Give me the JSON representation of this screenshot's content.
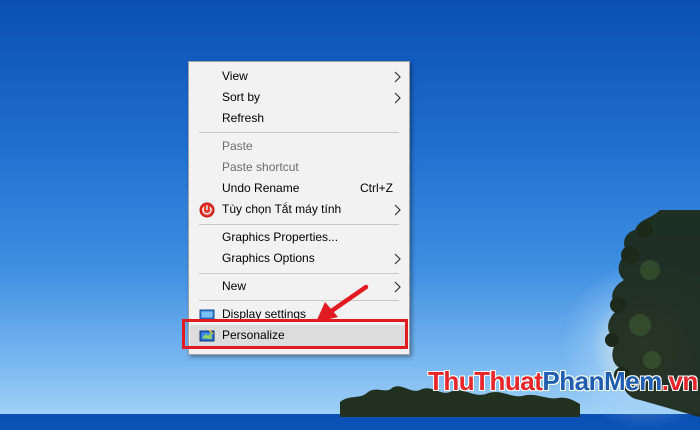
{
  "colors": {
    "highlight_border": "#e21b22",
    "menu_background": "#f2f2f2",
    "hover_background": "#dcdcdc",
    "disabled_text": "#6d6d6d",
    "watermark_red": "#e7262b",
    "watermark_blue": "#1f5db0"
  },
  "context_menu": {
    "items": [
      {
        "label": "View",
        "submenu": true
      },
      {
        "label": "Sort by",
        "submenu": true
      },
      {
        "label": "Refresh"
      },
      {
        "label": "Paste",
        "disabled": true
      },
      {
        "label": "Paste shortcut",
        "disabled": true
      },
      {
        "label": "Undo Rename",
        "shortcut": "Ctrl+Z"
      },
      {
        "label": "Tùy chọn Tắt máy tính",
        "icon": "power-icon",
        "submenu": true
      },
      {
        "label": "Graphics Properties..."
      },
      {
        "label": "Graphics Options",
        "submenu": true
      },
      {
        "label": "New",
        "submenu": true
      },
      {
        "label": "Display settings",
        "icon": "display-settings-icon"
      },
      {
        "label": "Personalize",
        "icon": "personalize-icon",
        "highlighted": true
      }
    ]
  },
  "watermark": {
    "part1": "ThuThuat",
    "part2": "PhanMem",
    "part3": ".vn"
  }
}
